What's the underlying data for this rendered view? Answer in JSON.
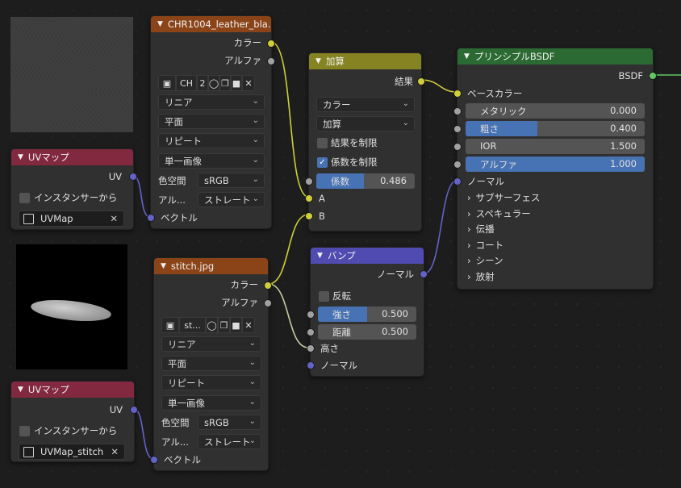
{
  "texture1": {
    "title": "CHR1004_leather_bla...",
    "out_color": "カラー",
    "out_alpha": "アルファ",
    "image_short": "CH",
    "users": "2",
    "interpolation": "リニア",
    "projection": "平面",
    "extension": "リピート",
    "source": "単一画像",
    "colorspace_label": "色空間",
    "colorspace": "sRGB",
    "alpha_label": "アル...",
    "alpha_mode": "ストレート",
    "in_vector": "ベクトル"
  },
  "texture2": {
    "title": "stitch.jpg",
    "out_color": "カラー",
    "out_alpha": "アルファ",
    "image_short": "st...",
    "interpolation": "リニア",
    "projection": "平面",
    "extension": "リピート",
    "source": "単一画像",
    "colorspace_label": "色空間",
    "colorspace": "sRGB",
    "alpha_label": "アル...",
    "alpha_mode": "ストレート",
    "in_vector": "ベクトル"
  },
  "uvmap1": {
    "title": "UVマップ",
    "out_uv": "UV",
    "instancer": "インスタンサーから",
    "map": "UVMap"
  },
  "uvmap2": {
    "title": "UVマップ",
    "out_uv": "UV",
    "instancer": "インスタンサーから",
    "map": "UVMap_stitch"
  },
  "math": {
    "title": "加算",
    "out_result": "結果",
    "data_type": "カラー",
    "blend": "加算",
    "clamp_result": "結果を制限",
    "clamp_result_checked": false,
    "clamp_factor": "係数を制限",
    "clamp_factor_checked": true,
    "factor_label": "係数",
    "factor_value": "0.486",
    "factor_fraction": 0.486,
    "in_a": "A",
    "in_b": "B"
  },
  "bump": {
    "title": "バンプ",
    "out_normal": "ノーマル",
    "invert": "反転",
    "strength_label": "強さ",
    "strength_value": "0.500",
    "strength_fraction": 0.5,
    "distance_label": "距離",
    "distance_value": "0.500",
    "in_height": "高さ",
    "in_normal": "ノーマル"
  },
  "bsdf": {
    "title": "プリンシプルBSDF",
    "out_bsdf": "BSDF",
    "base_color": "ベースカラー",
    "metallic_label": "メタリック",
    "metallic_value": "0.000",
    "roughness_label": "粗さ",
    "roughness_value": "0.400",
    "roughness_fraction": 0.4,
    "ior_label": "IOR",
    "ior_value": "1.500",
    "alpha_label": "アルファ",
    "alpha_value": "1.000",
    "alpha_fraction": 1.0,
    "normal": "ノーマル",
    "panels": [
      "サブサーフェス",
      "スペキュラー",
      "伝播",
      "コート",
      "シーン",
      "放射"
    ]
  },
  "colors": {
    "socket_color": "#cfcf3a",
    "socket_float": "#a1a1a1",
    "socket_vector": "#6363c7",
    "socket_shader": "#63c763",
    "accent": "#4772b3"
  }
}
